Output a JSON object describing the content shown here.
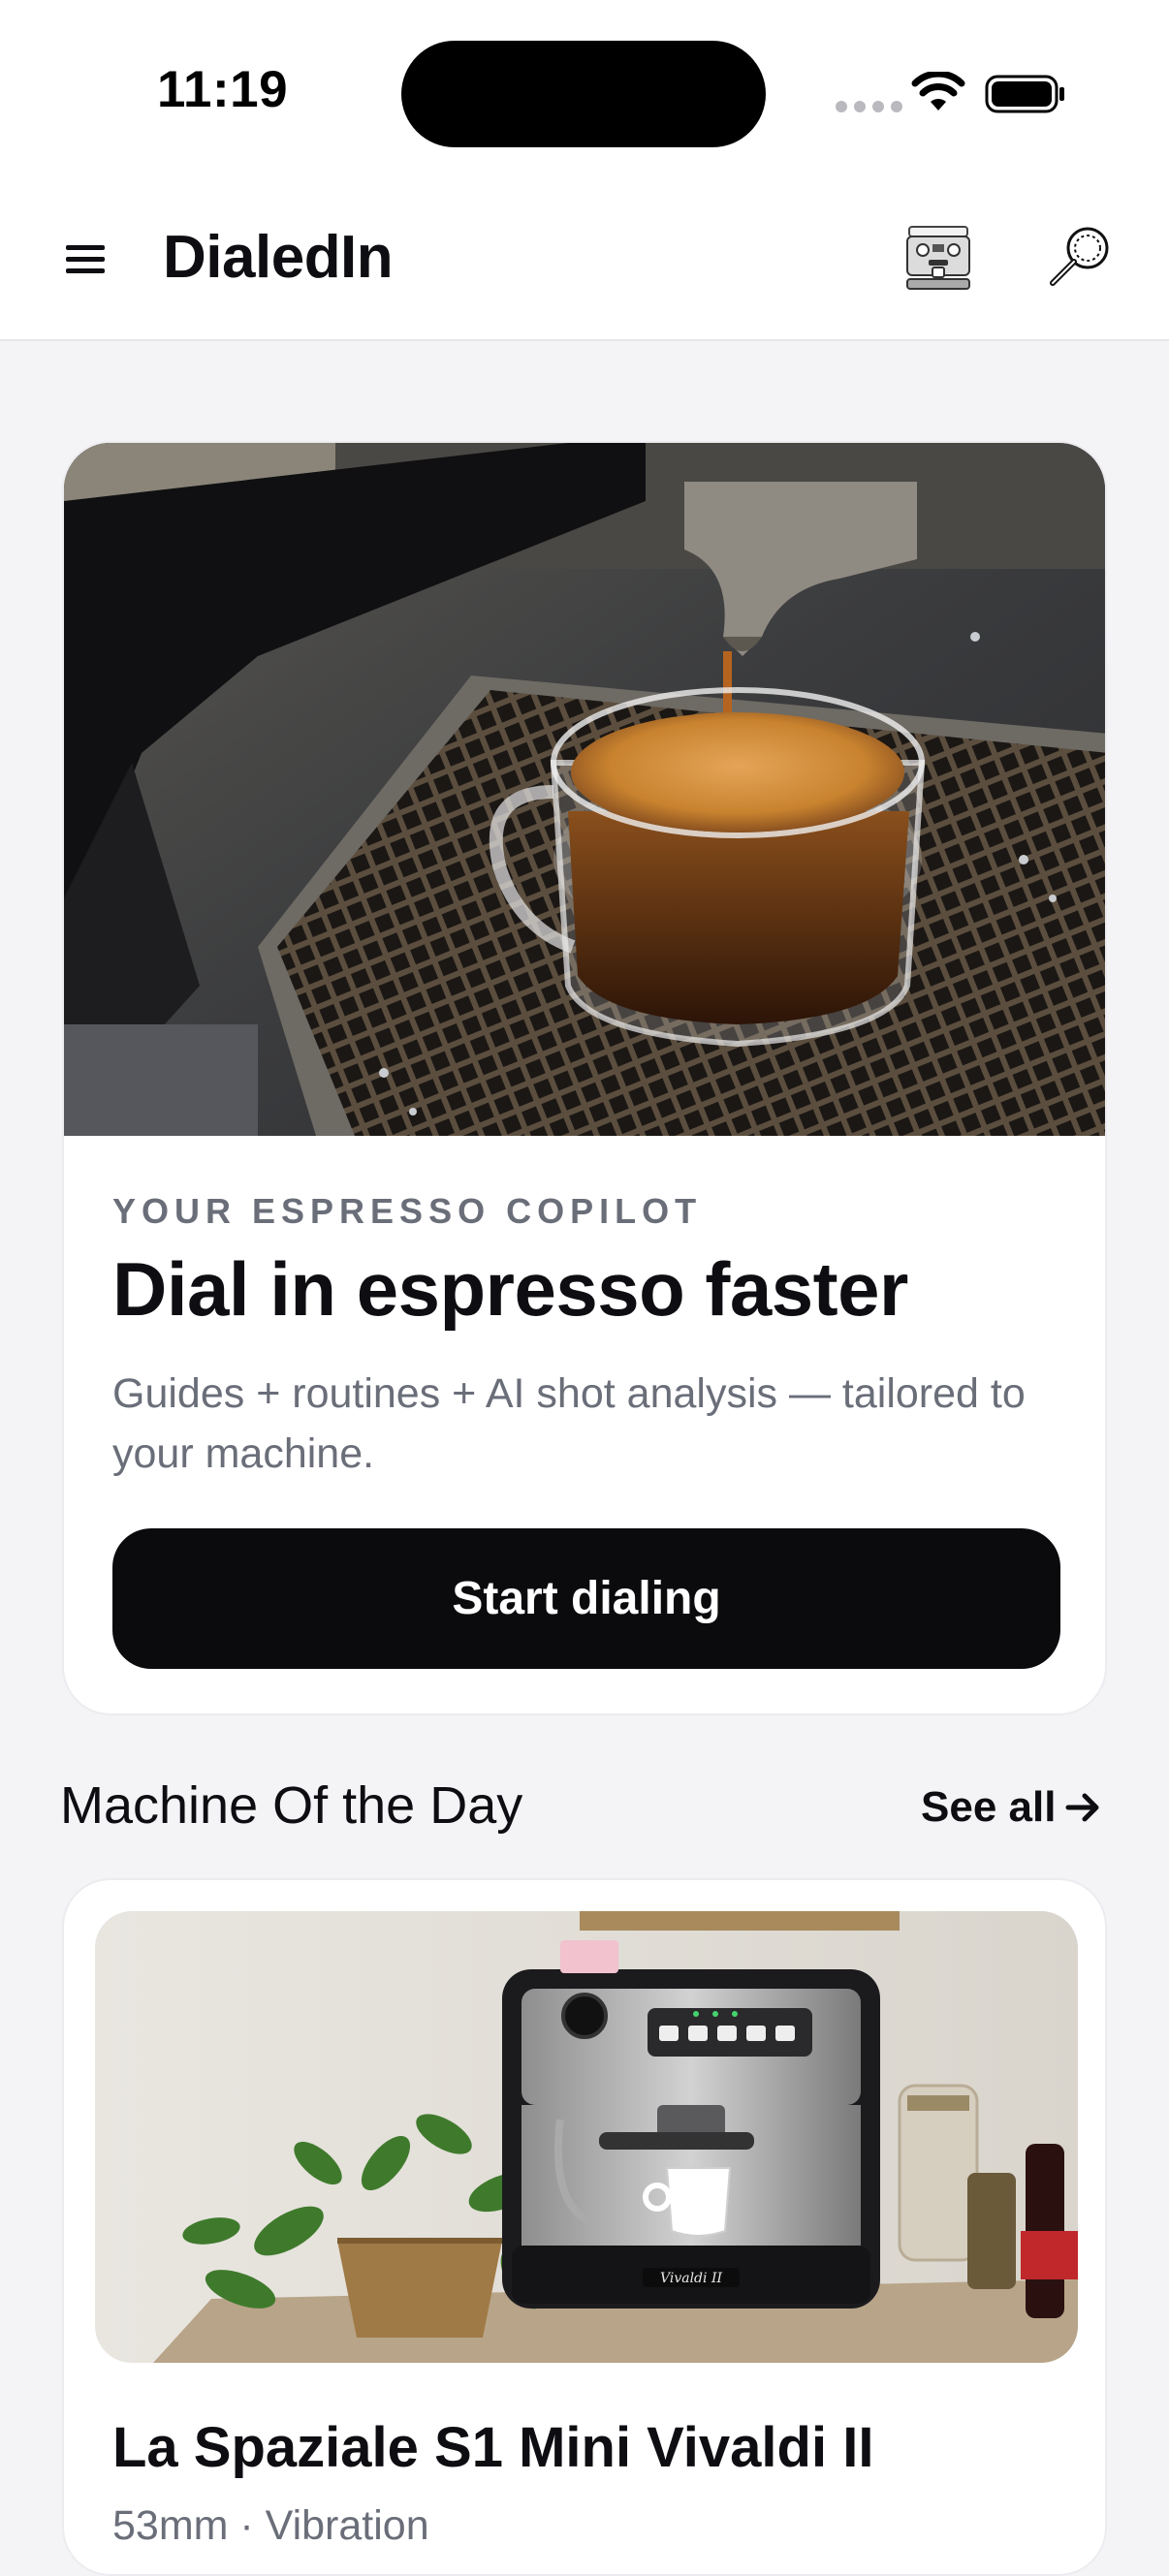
{
  "status_bar": {
    "time": "11:19"
  },
  "header": {
    "title": "DialedIn",
    "icons": [
      "menu-icon",
      "espresso-machine-icon",
      "portafilter-search-icon"
    ]
  },
  "hero": {
    "eyebrow": "YOUR ESPRESSO COPILOT",
    "title": "Dial in espresso faster",
    "subtitle": "Guides + routines + AI shot analysis — tailored to your machine.",
    "cta_label": "Start dialing",
    "image": "espresso-shot-photo"
  },
  "machine_of_day": {
    "section_title": "Machine Of the Day",
    "see_all_label": "See all",
    "machine_name": "La Spaziale S1 Mini Vivaldi II",
    "specs": "53mm · Vibration",
    "badge_text": "Vivaldi II",
    "image": "espresso-machine-photo"
  },
  "colors": {
    "background": "#f4f4f6",
    "card": "#ffffff",
    "primary_button": "#0b0b0e",
    "muted_text": "#6a6e79"
  }
}
